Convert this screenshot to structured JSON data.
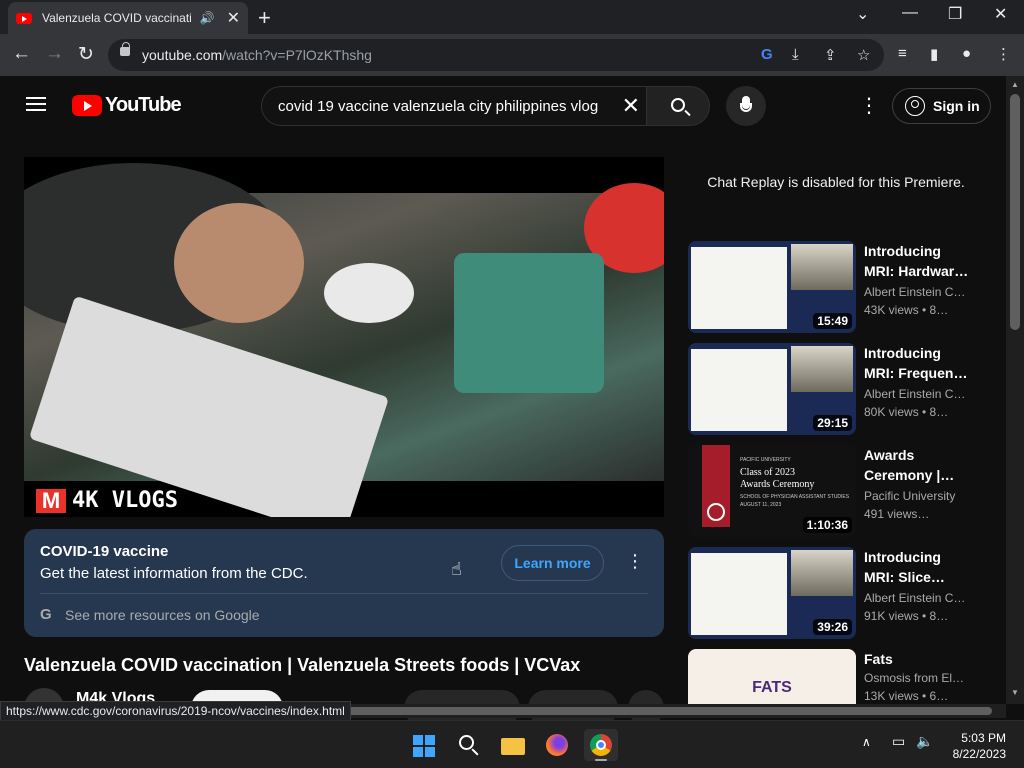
{
  "browser": {
    "tab_title": "Valenzuela COVID vaccination | Valenzuela Streets foods | VCVax",
    "url_host": "youtube.com",
    "url_path": "/watch?v=P7lOzKThshg"
  },
  "masthead": {
    "logo_text": "YouTube",
    "search_query": "covid 19 vaccine valenzuela city philippines vlog",
    "sign_in_label": "Sign in"
  },
  "player": {
    "watermark_letter": "M",
    "watermark_text": "4K VLOGS"
  },
  "info_panel": {
    "heading": "COVID-19 vaccine",
    "description": "Get the latest information from the CDC.",
    "learn_more_label": "Learn more",
    "google_letter": "G",
    "more_resources": "See more resources on Google"
  },
  "video": {
    "title": "Valenzuela COVID vaccination | Valenzuela Streets foods | VCVax",
    "channel": "M4k Vlogs"
  },
  "sidebar": {
    "chat_replay_notice": "Chat Replay is disabled for this Premiere.",
    "recommendations": [
      {
        "title": "Introducing MRI: Hardwar…",
        "channel": "Albert Einstein C…",
        "views": "43K views • 8…",
        "duration": "15:49"
      },
      {
        "title": "Introducing MRI: Frequen…",
        "channel": "Albert Einstein C…",
        "views": "80K views • 8…",
        "duration": "29:15"
      },
      {
        "title": "Awards Ceremony |…",
        "channel": "Pacific University",
        "views": "491 views…",
        "duration": "1:10:36",
        "thumb_l1": "PACIFIC UNIVERSITY",
        "thumb_l2": "Class of 2023",
        "thumb_l3": "Awards Ceremony",
        "thumb_l4": "SCHOOL OF PHYSICIAN ASSISTANT STUDIES",
        "thumb_l5": "AUGUST 11, 2023"
      },
      {
        "title": "Introducing MRI: Slice…",
        "channel": "Albert Einstein C…",
        "views": "91K views • 8…",
        "duration": "39:26"
      },
      {
        "title": "Fats",
        "channel": "Osmosis from El…",
        "views": "13K views • 6…",
        "thumb_word": "FATS"
      }
    ]
  },
  "status_bar": {
    "hover_url": "https://www.cdc.gov/coronavirus/2019-ncov/vaccines/index.html"
  },
  "taskbar": {
    "time": "5:03 PM",
    "date": "8/22/2023"
  },
  "colors": {
    "youtube_red": "#ff0000",
    "info_panel_bg": "#263850",
    "link_blue": "#3ea6ff"
  }
}
